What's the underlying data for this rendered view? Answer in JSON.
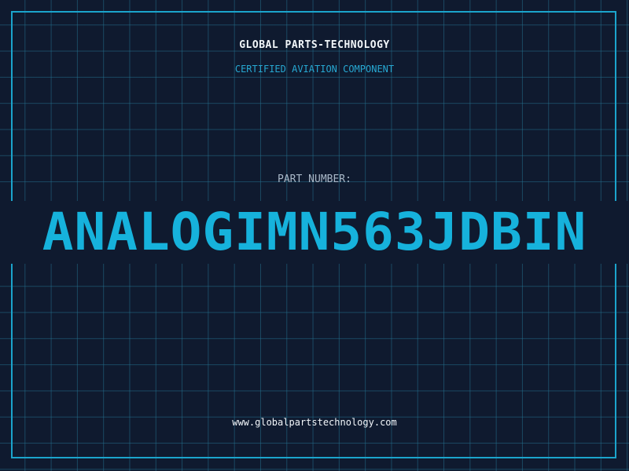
{
  "label": {
    "company": "GLOBAL PARTS-TECHNOLOGY",
    "subtitle": "CERTIFIED AVIATION COMPONENT",
    "part_number_label": "PART NUMBER:",
    "part_number": "ANALOGIMN563JDBIN",
    "website": "www.globalpartstechnology.com"
  },
  "colors": {
    "background": "#0f1a2f",
    "grid": "#236e8c",
    "accent": "#16b2dc",
    "text": "#f2f6fa"
  }
}
